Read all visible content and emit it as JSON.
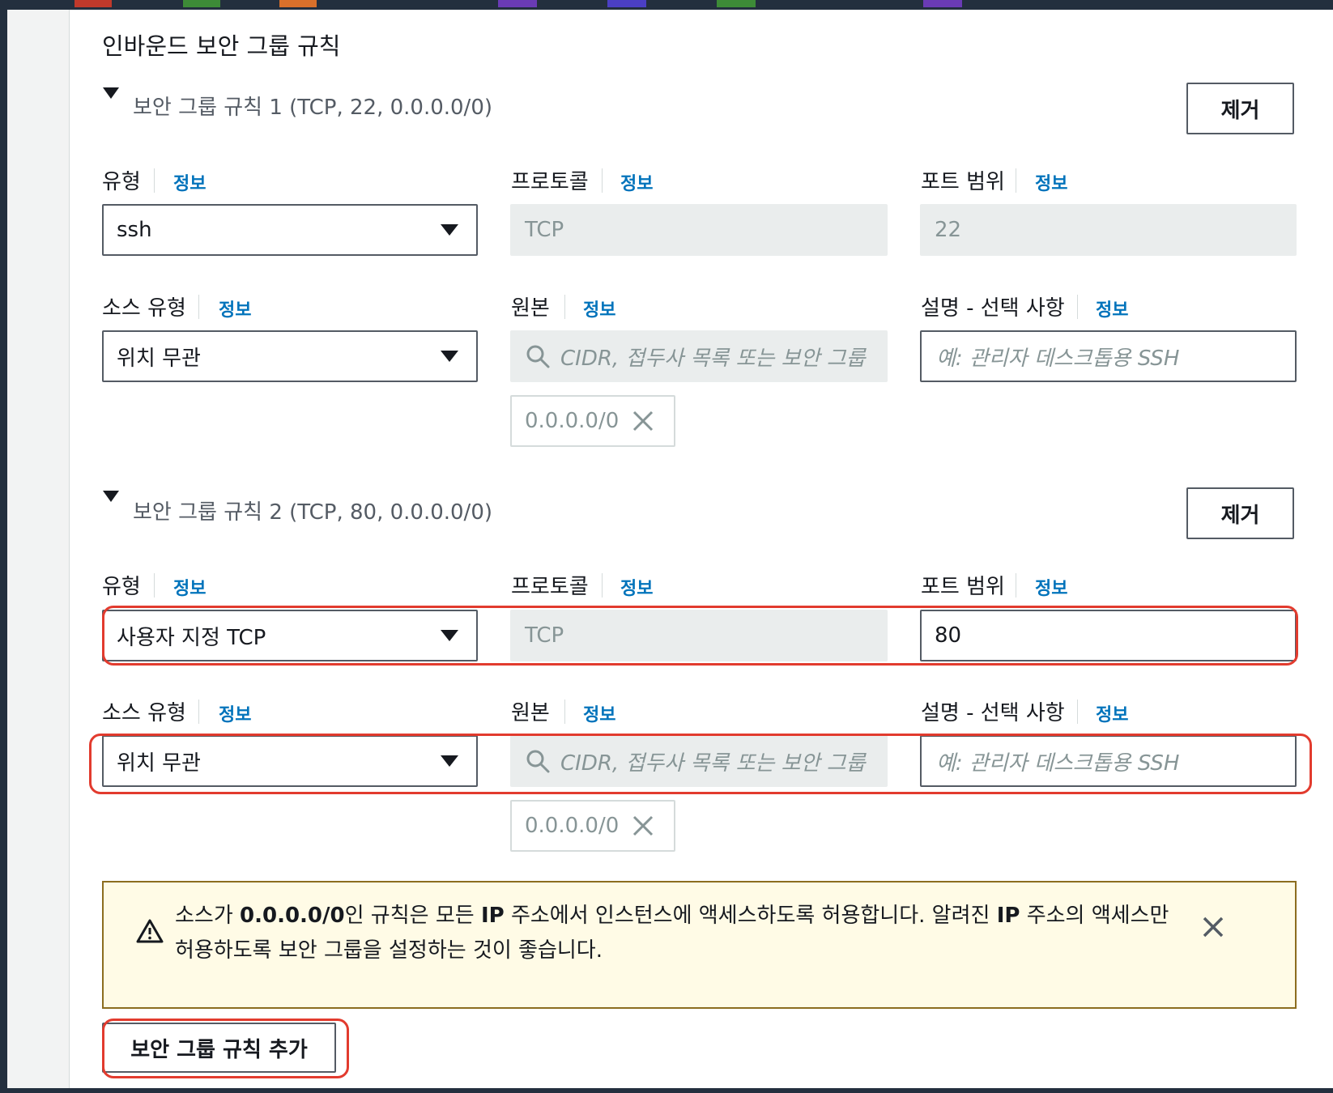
{
  "colors": {
    "accent_link": "#0073bb",
    "highlight": "#e23b2e",
    "alert_border": "#8c6d1f",
    "alert_bg": "#fffbe6",
    "top_strips": [
      "#c0392b",
      "#3d8b37",
      "#d9702b",
      "#6a3bb5",
      "#4b3fc4",
      "#3d8b37",
      "#6a3bb5"
    ]
  },
  "section": {
    "title": "인바운드 보안 그룹 규칙"
  },
  "labels": {
    "type": "유형",
    "protocol": "프로토콜",
    "port_range": "포트 범위",
    "source_type": "소스 유형",
    "source": "원본",
    "description": "설명 - 선택 사항",
    "info": "정보"
  },
  "rules": [
    {
      "header": "보안 그룹 규칙 1 (TCP, 22, 0.0.0.0/0)",
      "remove_label": "제거",
      "type_value": "ssh",
      "protocol_value": "TCP",
      "port_value": "22",
      "source_type_value": "위치 무관",
      "source_placeholder": "CIDR, 접두사 목록 또는 보안 그룹",
      "source_token": "0.0.0.0/0",
      "description_placeholder": "예: 관리자 데스크톱용 SSH"
    },
    {
      "header": "보안 그룹 규칙 2 (TCP, 80, 0.0.0.0/0)",
      "remove_label": "제거",
      "type_value": "사용자 지정 TCP",
      "protocol_value": "TCP",
      "port_value": "80",
      "source_type_value": "위치 무관",
      "source_placeholder": "CIDR, 접두사 목록 또는 보안 그룹",
      "source_token": "0.0.0.0/0",
      "description_placeholder": "예: 관리자 데스크톱용 SSH"
    }
  ],
  "alert": {
    "text_before": "소스가 ",
    "text_bold_cidr": "0.0.0.0/0",
    "text_mid1": "인 규칙은 모든 ",
    "text_bold_ip1": "IP",
    "text_mid2": " 주소에서 인스턴스에 액세스하도록 허용합니다. 알려진 ",
    "text_bold_ip2": "IP",
    "text_after": " 주소의 액세스만 허용하도록 보안 그룹을 설정하는 것이 좋습니다."
  },
  "add_rule_label": "보안 그룹 규칙 추가",
  "icons": [
    "caret-down-icon",
    "dropdown-arrow-icon",
    "search-icon",
    "close-icon",
    "warning-icon"
  ]
}
